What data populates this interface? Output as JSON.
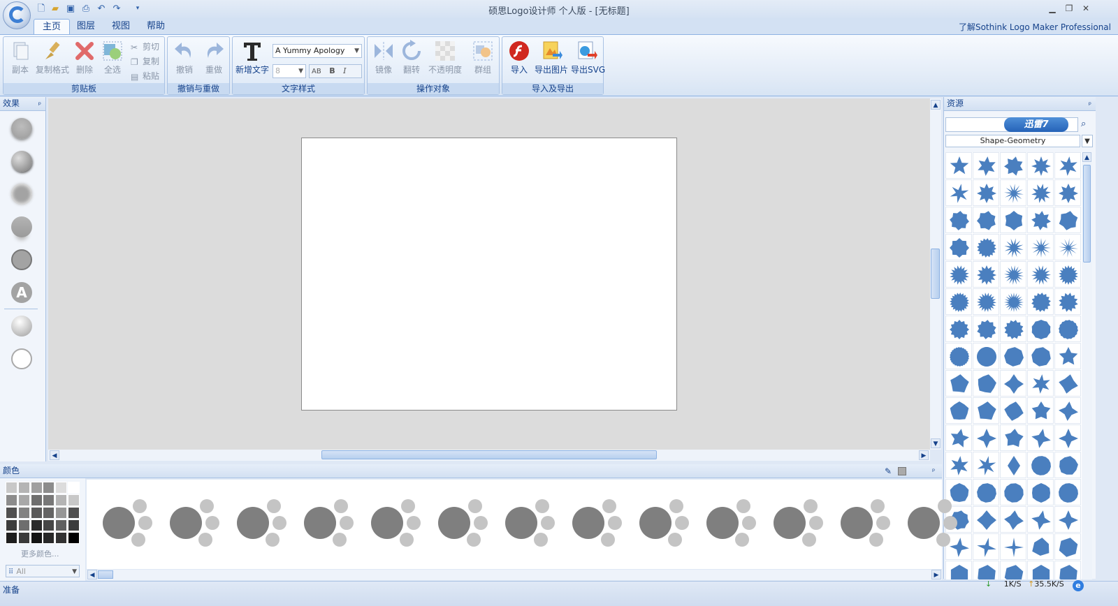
{
  "window": {
    "title": "硕思Logo设计师 个人版 - [无标题]",
    "about_link": "了解Sothink Logo Maker Professional",
    "min": "▁",
    "restore": "❐",
    "close": "✕"
  },
  "tabs": [
    {
      "label": "主页",
      "active": true
    },
    {
      "label": "图层"
    },
    {
      "label": "视图"
    },
    {
      "label": "帮助"
    }
  ],
  "ribbon": {
    "clipboard": {
      "label": "剪贴板",
      "duplicate": "副本",
      "copy_format": "复制格式",
      "delete": "删除",
      "select_all": "全选",
      "cut": "剪切",
      "copy": "复制",
      "paste": "粘贴"
    },
    "undo_redo": {
      "label": "撤销与重做",
      "undo": "撤销",
      "redo": "重做"
    },
    "text_style": {
      "label": "文字样式",
      "add_text": "新增文字",
      "font": "A Yummy Apology",
      "size": "8",
      "bold": "B",
      "italic": "I",
      "spacing": "AB"
    },
    "arrange": {
      "label": "操作对象",
      "mirror": "镜像",
      "rotate": "翻转",
      "opacity": "不透明度",
      "group": "群组"
    },
    "import_export": {
      "label": "导入及导出",
      "import": "导入",
      "export_image": "导出图片",
      "export_svg": "导出SVG"
    }
  },
  "effects_panel": {
    "title": "效果",
    "pin": "ᵖ"
  },
  "resources_panel": {
    "title": "资源",
    "pin": "ᵖ",
    "badge": "迅雷7",
    "category": "Shape-Geometry"
  },
  "colors_panel": {
    "title": "颜色",
    "more_colors": "更多颜色...",
    "filter": "All"
  },
  "palette": [
    "#c8c8c8",
    "#b4b4b4",
    "#a0a0a0",
    "#8c8c8c",
    "#dcdcdc",
    "#ffffff",
    "#8c8c8c",
    "#a8a8a8",
    "#6e6e6e",
    "#787878",
    "#b4b4b4",
    "#c8c8c8",
    "#505050",
    "#828282",
    "#5a5a5a",
    "#646464",
    "#969696",
    "#505050",
    "#3c3c3c",
    "#6e6e6e",
    "#2a2a2a",
    "#464646",
    "#606060",
    "#3c3c3c",
    "#1e1e1e",
    "#3a3a3a",
    "#141414",
    "#282828",
    "#323232",
    "#000000"
  ],
  "status": {
    "text": "准备",
    "down_speed": "1K/S",
    "up_speed": "35.5K/S"
  },
  "colors": {
    "shape_blue": "#4a7fbf",
    "pattern_dark": "#7f7f7f",
    "pattern_light": "#c4c4c4"
  }
}
